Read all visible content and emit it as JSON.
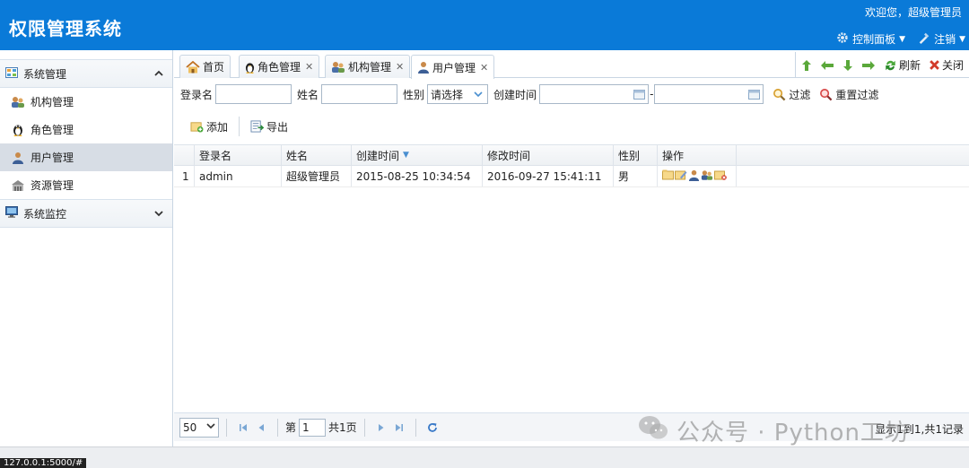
{
  "header": {
    "title": "权限管理系统",
    "welcome": "欢迎您，超级管理员",
    "menu": [
      {
        "label": "控制面板",
        "icon": "gear-icon"
      },
      {
        "label": "注销",
        "icon": "logout-icon"
      }
    ]
  },
  "sidebar": {
    "groups": [
      {
        "label": "系统管理",
        "expanded": true,
        "items": [
          {
            "label": "机构管理",
            "icon": "organization-icon"
          },
          {
            "label": "角色管理",
            "icon": "penguin-icon"
          },
          {
            "label": "用户管理",
            "icon": "user-icon",
            "active": true
          },
          {
            "label": "资源管理",
            "icon": "building-icon"
          }
        ]
      },
      {
        "label": "系统监控",
        "expanded": false
      }
    ]
  },
  "tabs": [
    {
      "label": "首页",
      "icon": "home-icon",
      "closable": false
    },
    {
      "label": "角色管理",
      "icon": "penguin-icon",
      "closable": true
    },
    {
      "label": "机构管理",
      "icon": "organization-icon",
      "closable": true
    },
    {
      "label": "用户管理",
      "icon": "user-icon",
      "closable": true,
      "active": true
    }
  ],
  "tab_tools": {
    "refresh": "刷新",
    "close": "关闭"
  },
  "filters": {
    "login_label": "登录名",
    "login_value": "",
    "name_label": "姓名",
    "name_value": "",
    "gender_label": "性别",
    "gender_value": "请选择",
    "ctime_label": "创建时间",
    "ctime_from": "",
    "ctime_to": "",
    "date_sep": "-",
    "filter_btn": "过滤",
    "reset_btn": "重置过滤"
  },
  "toolbar": {
    "add": "添加",
    "export": "导出"
  },
  "grid": {
    "columns": [
      "",
      "登录名",
      "姓名",
      "创建时间",
      "修改时间",
      "性别",
      "操作"
    ],
    "rows": [
      {
        "num": "1",
        "login": "admin",
        "name": "超级管理员",
        "ctime": "2015-08-25 10:34:54",
        "mtime": "2016-09-27 15:41:11",
        "gender": "男"
      }
    ]
  },
  "pager": {
    "page_size": "50",
    "page_prefix": "第",
    "page_value": "1",
    "total_pages": "共1页",
    "info": "显示1到1,共1记录"
  },
  "watermark": {
    "text": "公众号 · Python工坊"
  },
  "status": {
    "url": "127.0.0.1:5000/#"
  }
}
